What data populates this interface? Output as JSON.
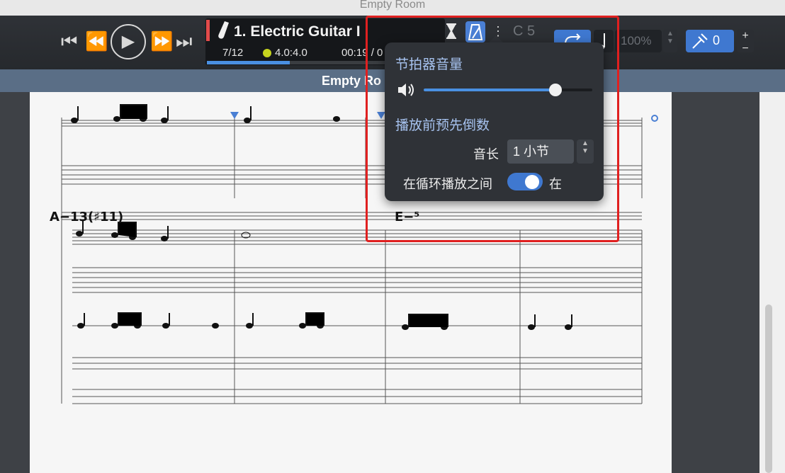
{
  "window": {
    "title": "Empty Room"
  },
  "transport": {
    "first": "⏮",
    "rewind": "⏪",
    "play": "▶",
    "forward": "⏩",
    "last": "⏭"
  },
  "track": {
    "name": "1. Electric Guitar I",
    "position": "7/12",
    "time_signature": "4.0:4.0",
    "time": "00:19 / 0",
    "progress": 0.35,
    "flag_color": "#e24b4b"
  },
  "toolbar": {
    "countdown_icon": "hourglass-icon",
    "metronome_icon": "metronome-icon",
    "more_icon": "⋮",
    "key": "C 5",
    "loop_icon": "loop-icon",
    "speed": "100%",
    "pitch_value": "0",
    "plus_label": "+",
    "minus_label": "−"
  },
  "document": {
    "title": "Empty Ro"
  },
  "popover": {
    "volume_heading": "节拍器音量",
    "volume_level": 0.78,
    "countdown_heading": "播放前预先倒数",
    "length_label": "音长",
    "length_value": "1 小节",
    "loop_label": "在循环播放之间",
    "loop_state": "在",
    "loop_on": true
  },
  "score": {
    "chord_1": "A−13(♯11)",
    "chord_2": "E−⁵"
  },
  "colors": {
    "accent": "#4a90e2",
    "header": "#5a6e86",
    "highlight": "#e02020"
  }
}
